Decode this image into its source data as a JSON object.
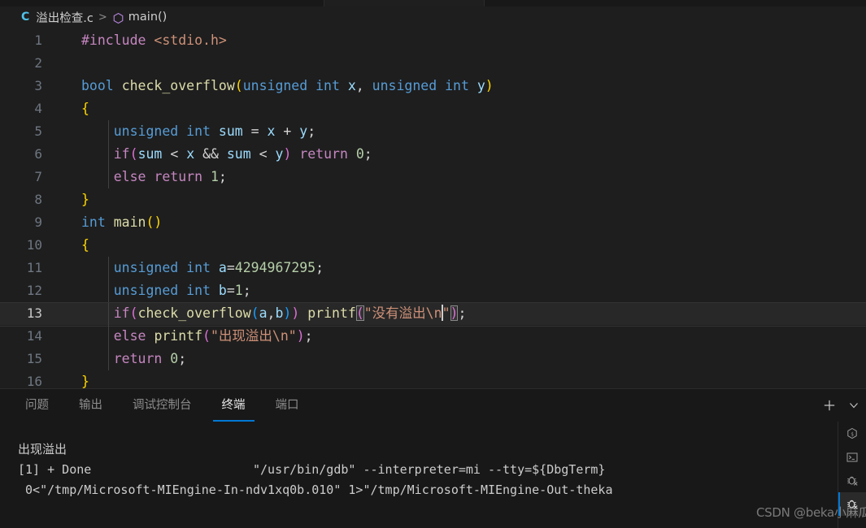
{
  "window": {
    "theme": "dark-plus",
    "colors": {
      "editor_bg": "#1e1e1e",
      "panel_bg": "#181818",
      "accent": "#0078d4",
      "keyword": "#569cd6",
      "control": "#c586c0",
      "string": "#ce9178",
      "number": "#b5cea8",
      "function": "#dcdcaa",
      "variable": "#9cdcfe"
    }
  },
  "breadcrumb": {
    "lang_badge": "C",
    "file_name": "溢出检查.c",
    "separator": ">",
    "symbol_icon": "symbol-method-icon",
    "symbol_name": "main()"
  },
  "editor": {
    "language": "c",
    "active_line": 13,
    "cursor": {
      "line": 13,
      "after": "\\n"
    },
    "lines": [
      {
        "n": 1,
        "text": "#include <stdio.h>"
      },
      {
        "n": 2,
        "text": ""
      },
      {
        "n": 3,
        "text": "bool check_overflow(unsigned int x, unsigned int y)"
      },
      {
        "n": 4,
        "text": "{"
      },
      {
        "n": 5,
        "text": "    unsigned int sum = x + y;"
      },
      {
        "n": 6,
        "text": "    if(sum < x && sum < y) return 0;"
      },
      {
        "n": 7,
        "text": "    else return 1;"
      },
      {
        "n": 8,
        "text": "}"
      },
      {
        "n": 9,
        "text": "int main()"
      },
      {
        "n": 10,
        "text": "{"
      },
      {
        "n": 11,
        "text": "    unsigned int a=4294967295;"
      },
      {
        "n": 12,
        "text": "    unsigned int b=1;"
      },
      {
        "n": 13,
        "text": "    if(check_overflow(a,b)) printf(\"没有溢出\\n\");"
      },
      {
        "n": 14,
        "text": "    else printf(\"出现溢出\\n\");"
      },
      {
        "n": 15,
        "text": "    return 0;"
      },
      {
        "n": 16,
        "text": "}"
      }
    ]
  },
  "panel": {
    "tabs": [
      {
        "id": "problems",
        "label": "问题",
        "active": false
      },
      {
        "id": "output",
        "label": "输出",
        "active": false
      },
      {
        "id": "debug-console",
        "label": "调试控制台",
        "active": false
      },
      {
        "id": "terminal",
        "label": "终端",
        "active": true
      },
      {
        "id": "ports",
        "label": "端口",
        "active": false
      }
    ],
    "actions": [
      {
        "id": "new-terminal",
        "icon": "plus-icon",
        "label": "+"
      },
      {
        "id": "terminal-dropdown",
        "icon": "chevron-down-icon",
        "label": "⌄"
      }
    ],
    "terminal": {
      "output_lines": [
        "出现溢出",
        "[1] + Done                      \"/usr/bin/gdb\" --interpreter=mi --tty=${DbgTerm}",
        " 0<\"/tmp/Microsoft-MIEngine-In-ndv1xq0b.010\" 1>\"/tmp/Microsoft-MIEngine-Out-theka"
      ],
      "instances": [
        {
          "id": "shell-bash",
          "icon": "shell-icon",
          "selected": false
        },
        {
          "id": "terminal-1",
          "icon": "terminal-prompt-icon",
          "selected": false
        },
        {
          "id": "debug-1",
          "icon": "debug-bug-icon",
          "selected": false
        },
        {
          "id": "debug-2",
          "icon": "debug-bug-icon",
          "selected": true
        }
      ]
    }
  },
  "watermark": {
    "text": "CSDN @beka小麻瓜"
  }
}
